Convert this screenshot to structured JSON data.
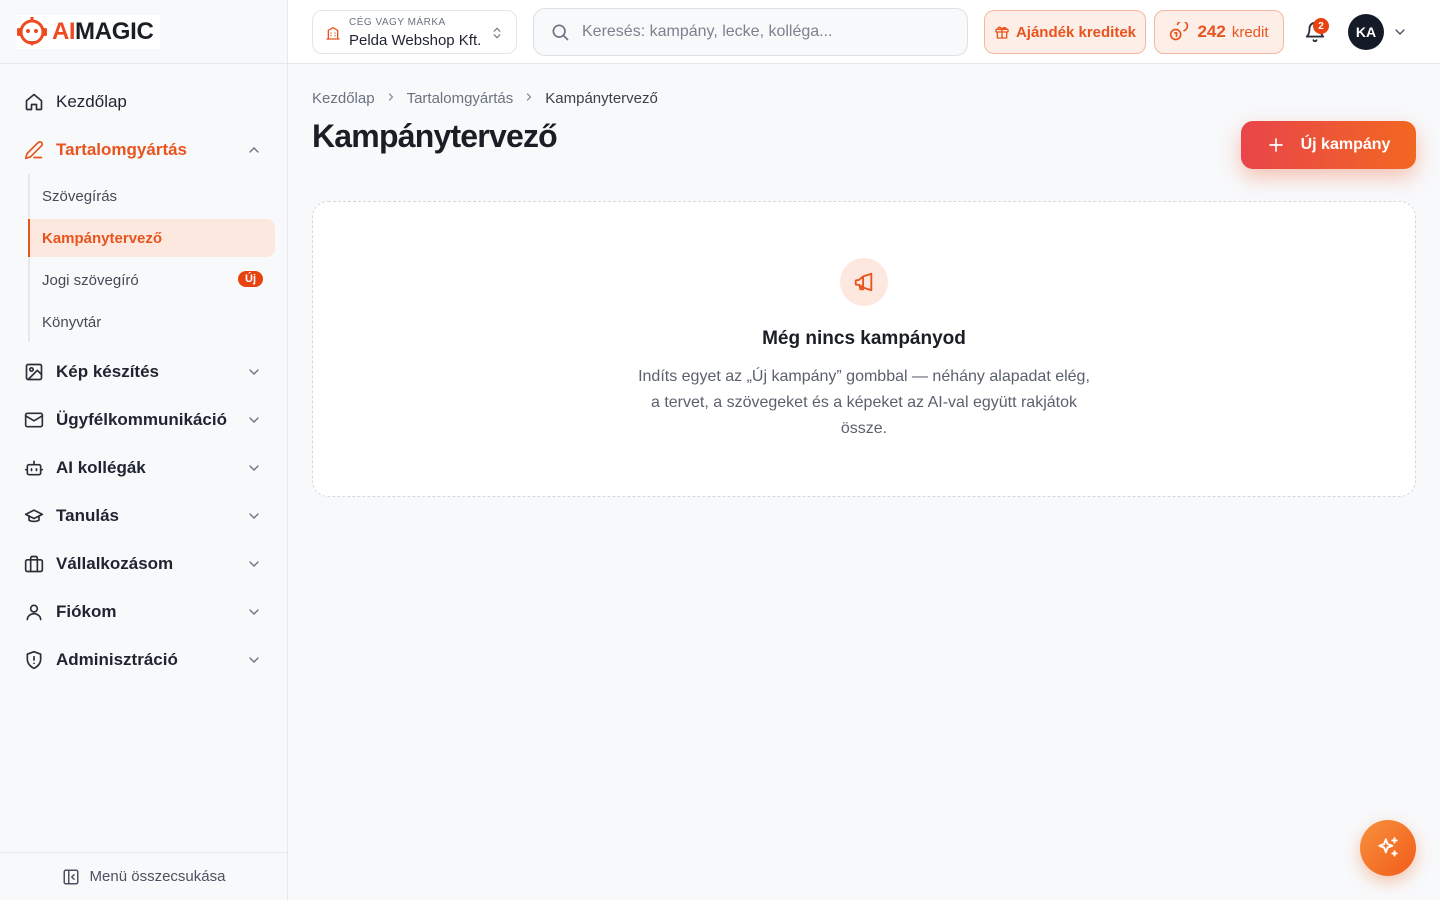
{
  "brand": {
    "logo_prefix": "AI",
    "logo_suffix": "MAGIC",
    "accent": "#e8541e"
  },
  "sidebar": {
    "items": [
      {
        "label": "Kezdőlap",
        "icon": "home-icon"
      },
      {
        "label": "Tartalomgyártás",
        "icon": "pencil-icon",
        "expanded": true
      },
      {
        "label": "Kép készítés",
        "icon": "image-icon"
      },
      {
        "label": "Ügyfélkommunikáció",
        "icon": "mail-icon"
      },
      {
        "label": "AI kollégák",
        "icon": "robot-icon"
      },
      {
        "label": "Tanulás",
        "icon": "graduation-cap-icon"
      },
      {
        "label": "Vállalkozásom",
        "icon": "briefcase-icon"
      },
      {
        "label": "Fiókom",
        "icon": "user-icon"
      },
      {
        "label": "Adminisztráció",
        "icon": "shield-icon"
      }
    ],
    "subitems": [
      {
        "label": "Szövegírás"
      },
      {
        "label": "Kampánytervező",
        "active": true
      },
      {
        "label": "Jogi szövegíró",
        "badge": "Új"
      },
      {
        "label": "Könyvtár"
      }
    ],
    "collapse_label": "Menü összecsukása"
  },
  "topbar": {
    "company_caption": "CÉG VAGY MÁRKA",
    "company_name": "Pelda Webshop Kft.",
    "search_placeholder": "Keresés: kampány, lecke, kolléga...",
    "gift_label": "Ajándék kreditek",
    "credit_amount": "242",
    "credit_unit": "kredit",
    "notification_count": "2",
    "avatar_initials": "KA"
  },
  "main": {
    "breadcrumb": [
      "Kezdőlap",
      "Tartalomgyártás",
      "Kampánytervező"
    ],
    "title": "Kampánytervező",
    "new_button_label": "Új kampány",
    "empty_title": "Még nincs kampányod",
    "empty_description": "Indíts egyet az „Új kampány” gombbal — néhány alapadat elég, a tervet, a szövegeket és a képeket az AI-val együtt rakjátok össze."
  }
}
